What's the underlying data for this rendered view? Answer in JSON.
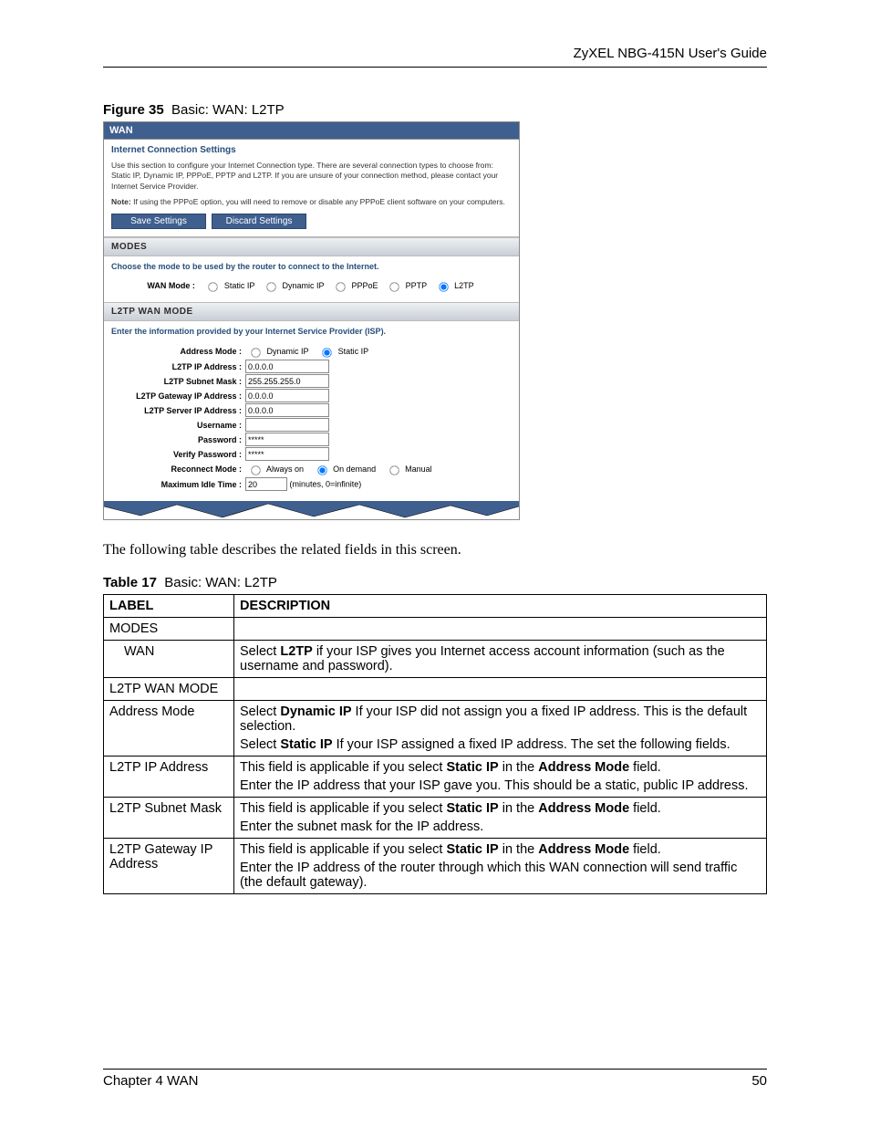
{
  "doc_header": "ZyXEL NBG-415N User's Guide",
  "figure": {
    "number": "Figure 35",
    "title": "Basic: WAN: L2TP"
  },
  "router": {
    "title": "WAN",
    "settings_heading": "Internet Connection Settings",
    "desc": "Use this section to configure your Internet Connection type. There are several connection types to choose from: Static IP, Dynamic IP, PPPoE, PPTP and L2TP. If you are unsure of your connection method, please contact your Internet Service Provider.",
    "note_label": "Note:",
    "note_text": "If using the PPPoE option, you will need to remove or disable any PPPoE client software on your computers.",
    "save_btn": "Save Settings",
    "discard_btn": "Discard Settings",
    "modes_header": "MODES",
    "modes_desc": "Choose the mode to be used by the router to connect to the Internet.",
    "wan_mode_label": "WAN Mode :",
    "wan_modes": {
      "static": "Static IP",
      "dynamic": "Dynamic IP",
      "pppoe": "PPPoE",
      "pptp": "PPTP",
      "l2tp": "L2TP"
    },
    "l2tp_header": "L2TP WAN MODE",
    "l2tp_desc": "Enter the information provided by your Internet Service Provider (ISP).",
    "fields": {
      "address_mode_label": "Address Mode :",
      "addr_dynamic": "Dynamic IP",
      "addr_static": "Static IP",
      "ip_label": "L2TP IP Address :",
      "ip_value": "0.0.0.0",
      "mask_label": "L2TP Subnet Mask :",
      "mask_value": "255.255.255.0",
      "gw_label": "L2TP Gateway IP Address :",
      "gw_value": "0.0.0.0",
      "server_label": "L2TP Server IP Address :",
      "server_value": "0.0.0.0",
      "user_label": "Username :",
      "user_value": "",
      "pass_label": "Password :",
      "pass_value": "*****",
      "vpass_label": "Verify Password :",
      "vpass_value": "*****",
      "reconnect_label": "Reconnect Mode :",
      "rc_always": "Always on",
      "rc_demand": "On demand",
      "rc_manual": "Manual",
      "idle_label": "Maximum Idle Time :",
      "idle_value": "20",
      "idle_suffix": "(minutes, 0=infinite)"
    }
  },
  "body_para": "The following table describes the related fields in this screen.",
  "table_caption": {
    "number": "Table 17",
    "title": "Basic: WAN: L2TP"
  },
  "table_headers": {
    "label": "LABEL",
    "description": "DESCRIPTION"
  },
  "table_rows": [
    {
      "label": "MODES",
      "desc_html": ""
    },
    {
      "label_indent": true,
      "label": "WAN",
      "desc_html": "Select <b>L2TP</b> if your ISP gives you Internet access account information (such as the username and password)."
    },
    {
      "label": "L2TP WAN MODE",
      "desc_html": ""
    },
    {
      "label": "Address Mode",
      "desc_html": "<div class='desc-para'>Select <b>Dynamic IP</b> If your ISP did not assign you a fixed IP address. This is the default selection.</div><div class='desc-para'>Select <b>Static IP</b> If your ISP assigned a fixed IP address. The set the following fields.</div>"
    },
    {
      "label": "L2TP IP Address",
      "desc_html": "<div class='desc-para'>This field is applicable if you select <b>Static IP</b> in the <b>Address Mode</b> field.</div><div class='desc-para'>Enter the IP address that your ISP gave you. This should be a static, public IP address.</div>"
    },
    {
      "label": "L2TP Subnet Mask",
      "desc_html": "<div class='desc-para'>This field is applicable if you select <b>Static IP</b> in the <b>Address Mode</b> field.</div><div class='desc-para'>Enter the subnet mask for the IP address.</div>"
    },
    {
      "label": "L2TP Gateway IP Address",
      "desc_html": "<div class='desc-para'>This field is applicable if you select <b>Static IP</b> in the <b>Address Mode</b> field.</div><div class='desc-para'>Enter the IP address of the router through which this WAN connection will send traffic (the default gateway).</div>"
    }
  ],
  "footer": {
    "chapter": "Chapter 4 WAN",
    "page": "50"
  }
}
